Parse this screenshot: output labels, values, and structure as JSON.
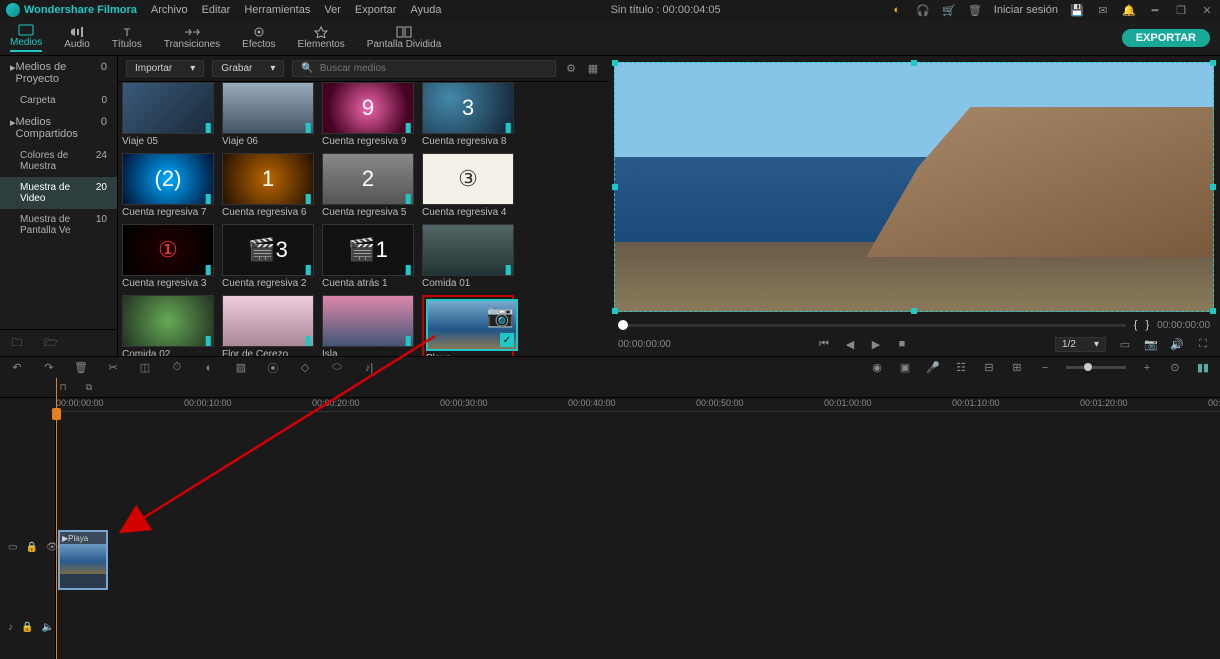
{
  "app": {
    "name": "Wondershare Filmora",
    "doc_title": "Sin título",
    "doc_time": "00:00:04:05"
  },
  "menu": [
    "Archivo",
    "Editar",
    "Herramientas",
    "Ver",
    "Exportar",
    "Ayuda"
  ],
  "session_label": "Iniciar sesión",
  "tabs": [
    "Medios",
    "Audio",
    "Títulos",
    "Transiciones",
    "Efectos",
    "Elementos",
    "Pantalla Dividida"
  ],
  "active_tab": "Medios",
  "export_label": "EXPORTAR",
  "sidebar": {
    "items": [
      {
        "label": "Medios de Proyecto",
        "count": 0,
        "head": true
      },
      {
        "label": "Carpeta",
        "count": 0,
        "child": true
      },
      {
        "label": "Medios Compartidos",
        "count": 0,
        "head": true
      },
      {
        "label": "Colores de Muestra",
        "count": 24,
        "child": true
      },
      {
        "label": "Muestra de Video",
        "count": 20,
        "child": true,
        "selected": true
      },
      {
        "label": "Muestra de Pantalla Ve",
        "count": 10,
        "child": true
      }
    ]
  },
  "mediabar": {
    "import": "Importar",
    "record": "Grabar",
    "search_ph": "Buscar medios"
  },
  "clips": [
    {
      "label": "Viaje 05",
      "bg": "linear-gradient(135deg,#3a5a7a,#1a2a3a)",
      "dl": true
    },
    {
      "label": "Viaje 06",
      "bg": "linear-gradient(180deg,#9ab,#456)",
      "dl": true
    },
    {
      "label": "Cuenta regresiva 9",
      "bg": "radial-gradient(circle,#e6a 0%,#402 80%)",
      "txt": "9",
      "dl": true
    },
    {
      "label": "Cuenta regresiva 8",
      "bg": "radial-gradient(circle at 30% 30%,#48a,#123)",
      "txt": "3",
      "dl": true
    },
    {
      "label": "Cuenta regresiva 7",
      "bg": "radial-gradient(circle,#0af,#013)",
      "txt": "(2)",
      "dl": true
    },
    {
      "label": "Cuenta regresiva 6",
      "bg": "radial-gradient(circle,#b60,#210)",
      "txt": "1",
      "dl": true
    },
    {
      "label": "Cuenta regresiva 5",
      "bg": "linear-gradient(#888,#555)",
      "txt": "2",
      "dl": true
    },
    {
      "label": "Cuenta regresiva 4",
      "bg": "#f4f0e8",
      "txt": "③",
      "fg": "#333"
    },
    {
      "label": "Cuenta regresiva 3",
      "bg": "radial-gradient(circle,#200,#000)",
      "txt": "①",
      "fg": "#e33",
      "dl": true
    },
    {
      "label": "Cuenta regresiva 2",
      "bg": "#111",
      "txt": "🎬3",
      "dl": true
    },
    {
      "label": "Cuenta atrás 1",
      "bg": "#111",
      "txt": "🎬1",
      "dl": true
    },
    {
      "label": "Comida 01",
      "bg": "linear-gradient(#566,#233)",
      "dl": true
    },
    {
      "label": "Comida 02",
      "bg": "radial-gradient(circle,#6a5,#232)",
      "dl": true
    },
    {
      "label": "Flor de Cerezo",
      "bg": "linear-gradient(#ecd,#a89)",
      "dl": true
    },
    {
      "label": "Isla",
      "bg": "linear-gradient(180deg,#d8a,#457)",
      "dl": true
    },
    {
      "label": "Playa",
      "bg": "linear-gradient(180deg,#7ac 0%,#258 60%,#875 100%)",
      "sel": true,
      "hl": true
    }
  ],
  "preview": {
    "tc_left": "00:00:00:00",
    "tc_right": "00:00:00:00",
    "scale": "1/2"
  },
  "ruler": [
    "00:00:00:00",
    "00:00:10:00",
    "00:00:20:00",
    "00:00:30:00",
    "00:00:40:00",
    "00:00:50:00",
    "00:01:00:00",
    "00:01:10:00",
    "00:01:20:00",
    "00:"
  ],
  "timeline_clip": {
    "name": "Playa"
  }
}
